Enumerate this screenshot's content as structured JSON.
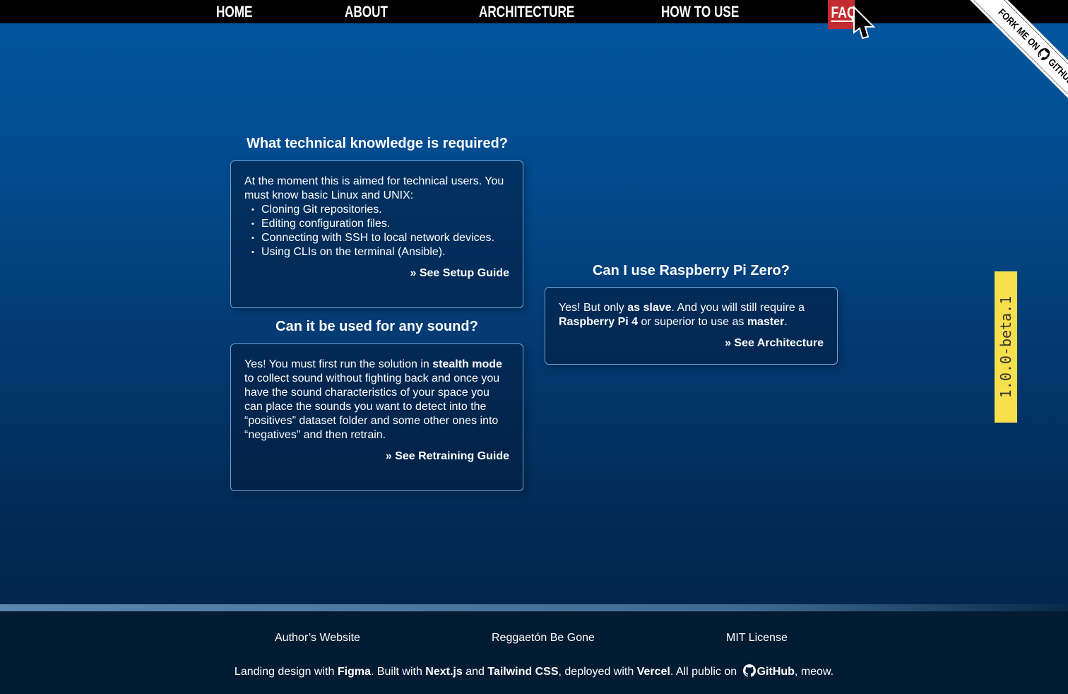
{
  "nav": {
    "items": [
      "HOME",
      "ABOUT",
      "ARCHITECTURE",
      "HOW TO USE"
    ],
    "active": "FAQ"
  },
  "ribbon": {
    "text_before": "FORK ME ON",
    "text_after": "GITHUB"
  },
  "faqs": [
    {
      "question": "What technical knowledge is required?",
      "intro": "At the moment this is aimed for technical users. You must know basic Linux and UNIX:",
      "bullets": [
        "Cloning Git repositories.",
        "Editing configuration files.",
        "Connecting with SSH to local network devices.",
        "Using CLIs on the terminal (Ansible)."
      ],
      "link": "» See Setup Guide"
    },
    {
      "question": "Can it be used for any sound?",
      "answer_parts": [
        "Yes! You must first run the solution in ",
        "stealth mode",
        " to collect sound without fighting back and once you have the sound characteristics of your space you can place the sounds you want to detect into the “positives” dataset folder and some other ones into “negatives” and then retrain."
      ],
      "link": "» See Retraining Guide"
    },
    {
      "question": "Can I use Raspberry Pi Zero?",
      "answer_parts": [
        "Yes! But only ",
        "as slave",
        ". And you will still require a ",
        "Raspberry Pi 4",
        " or superior to use as ",
        "master",
        "."
      ],
      "link": "» See Architecture"
    }
  ],
  "version": "1.0.0-beta.1",
  "footer": {
    "links": [
      "Author’s Website",
      "Reggaetón Be Gone",
      "MIT License"
    ],
    "credits": [
      "Landing design with ",
      "Figma",
      ". Built with ",
      "Next.js",
      " and ",
      "Tailwind CSS",
      ", deployed with ",
      "Vercel",
      ".  All public on ",
      "GitHub",
      ", meow."
    ]
  },
  "colors": {
    "nav_bg": "#000000",
    "faq_active": "#c22b2f",
    "version_bg": "#f7e04b",
    "footer_bg": "#031c33"
  }
}
